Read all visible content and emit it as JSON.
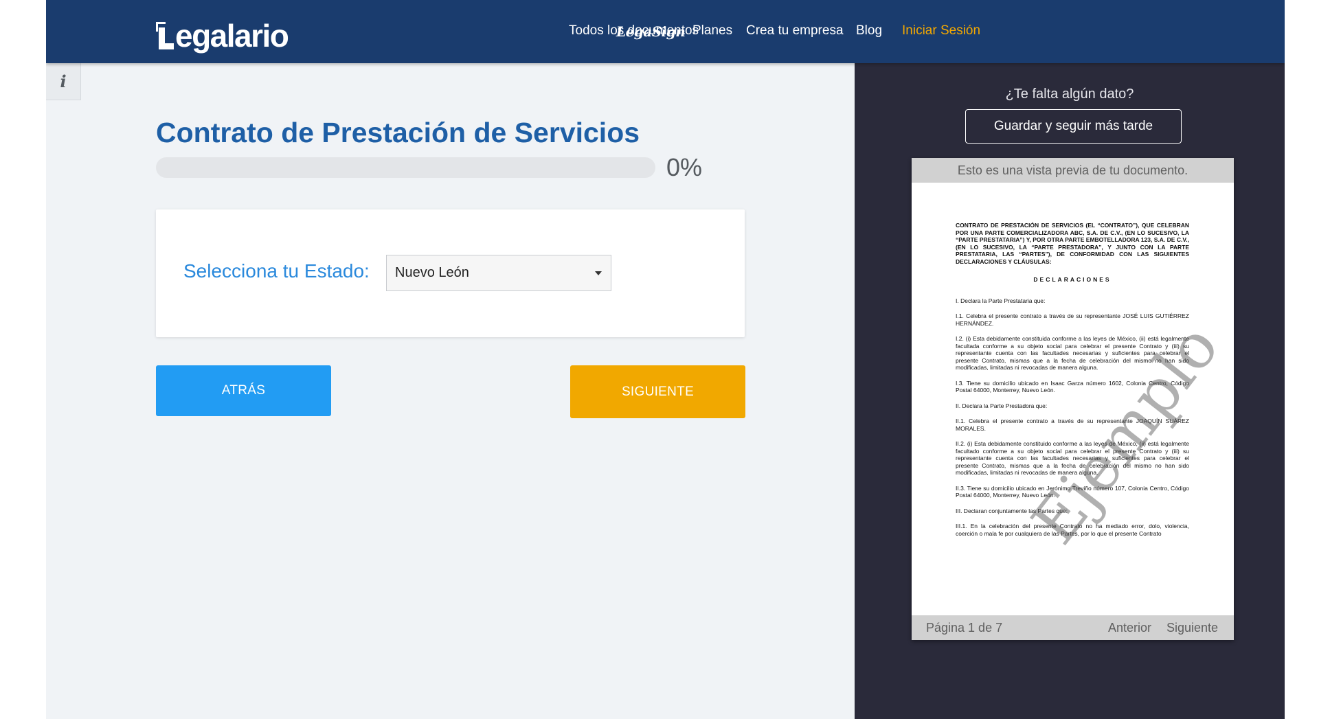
{
  "header": {
    "logo_text": "egalario",
    "legasign_label": "LegaSign",
    "nav": {
      "documents": "Todos los documentos",
      "plans": "Planes",
      "company": "Crea tu empresa",
      "blog": "Blog",
      "login": "Iniciar Sesión"
    },
    "colors": {
      "bar": "#1a3c6e",
      "login": "#f3a800"
    }
  },
  "sidebar": {
    "info_icon": "info-icon",
    "info_label": "i"
  },
  "form": {
    "title": "Contrato de Prestación de Servicios",
    "progress_fraction": 0,
    "progress_label": "0%",
    "state_label": "Selecciona tu Estado:",
    "state_value": "Nuevo León",
    "back_label": "ATRÁS",
    "next_label": "SIGUIENTE",
    "colors": {
      "title": "#1e5fa6",
      "back": "#229cf3",
      "next": "#f1a800"
    }
  },
  "preview": {
    "missing_text": "¿Te falta algún dato?",
    "save_label": "Guardar y seguir más tarde",
    "doc_header": "Esto es una vista previa de tu documento.",
    "watermark": "Ejemplo",
    "page_count": "Página 1 de 7",
    "prev_label": "Anterior",
    "next_label": "Siguiente",
    "paragraphs": [
      "CONTRATO DE PRESTACIÓN DE SERVICIOS (EL “CONTRATO”), QUE CELEBRAN POR UNA PARTE COMERCIALIZADORA ABC, S.A. DE C.V., (EN LO SUCESIVO, LA “PARTE PRESTATARIA”) Y, POR OTRA PARTE EMBOTELLADORA 123, S.A. DE C.V., (EN LO SUCESIVO, LA “PARTE PRESTADORA”, Y JUNTO CON LA PARTE PRESTATARIA, LAS “PARTES”), DE CONFORMIDAD CON LAS SIGUIENTES DECLARACIONES Y CLÁUSULAS:",
      "DECLARACIONES",
      "I.         Declara la Parte Prestataria que:",
      "I.1.         Celebra el presente contrato a través de su representante JOSÉ LUIS GUTIÉRREZ HERNÁNDEZ.",
      "I.2.    (i) Esta debidamente constituida conforme a las leyes de México, (ii) está legalmente facultada conforme a su objeto social para celebrar el presente Contrato y (iii) su representante cuenta con las facultades necesarias y suficientes para celebrar el presente Contrato, mismas que a la fecha de celebración del mismo no han sido modificadas, limitadas ni revocadas de manera alguna.",
      "I.3.    Tiene su domicilio ubicado en Isaac Garza número 1602, Colonia Centro, Código Postal 64000, Monterrey, Nuevo León.",
      "II.      Declara la Parte Prestadora que:",
      "II.1.    Celebra el presente contrato a través de su representante JOAQUÍN SUÁREZ MORALES.",
      "II.2.    (i) Esta debidamente constituido conforme a las leyes de México, (ii) está legalmente facultado conforme a su objeto social para celebrar el presente Contrato y (iii) su representante cuenta con las facultades necesarias y suficientes para celebrar el presente Contrato, mismas que a la fecha de celebración del mismo no han sido modificadas, limitadas ni revocadas de manera alguna.",
      "II.3.    Tiene su domicilio ubicado en Jerónimo Treviño número 107, Colonia Centro, Código Postal 64000, Monterrey, Nuevo León.",
      "III.     Declaran conjuntamente las Partes que:",
      "III.1. En la celebración del presente Contrato no ha mediado error, dolo, violencia, coerción o mala fe por cualquiera de las Partes, por lo que el presente Contrato"
    ],
    "colors": {
      "panel": "#2a2a3a",
      "bars": "#d1d1d1"
    }
  }
}
